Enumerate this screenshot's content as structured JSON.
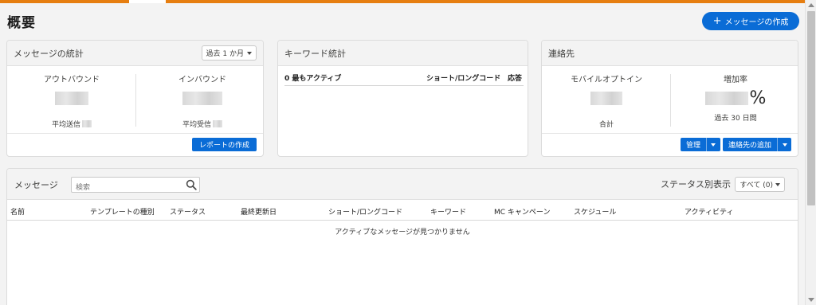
{
  "page": {
    "title": "概要"
  },
  "header": {
    "new_message_label": "メッセージの作成",
    "new_message_icon": "plus-icon"
  },
  "stats_card": {
    "title": "メッセージの統計",
    "period": "過去 1 か月",
    "outbound_label": "アウトバウンド",
    "outbound_sub": "平均送信",
    "inbound_label": "インバウンド",
    "inbound_sub": "平均受信",
    "report_button": "レポートの作成"
  },
  "keyword_card": {
    "title": "キーワード統計",
    "columns": [
      "0 最もアクティブ",
      "ショート/ロングコード",
      "応答"
    ]
  },
  "contacts_card": {
    "title": "連絡先",
    "mobile_optin_label": "モバイルオプトイン",
    "mobile_optin_sub": "合計",
    "growth_label": "増加率",
    "growth_unit": "%",
    "growth_sub": "過去 30 日間",
    "manage_button": "管理",
    "add_contact_button": "連絡先の追加"
  },
  "messages": {
    "title": "メッセージ",
    "search_placeholder": "検索",
    "status_filter_label": "ステータス別表示",
    "status_filter_value": "すべて (0)",
    "columns": [
      "名前",
      "テンプレートの種別",
      "ステータス",
      "最終更新日",
      "ショート/ロングコード",
      "キーワード",
      "MC キャンペーン",
      "スケジュール",
      "アクティビティ"
    ],
    "empty_text": "アクティブなメッセージが見つかりません"
  },
  "colors": {
    "accent": "#0a6cd6",
    "brand_bar": "#e67e10",
    "background": "#f3f3f3"
  }
}
